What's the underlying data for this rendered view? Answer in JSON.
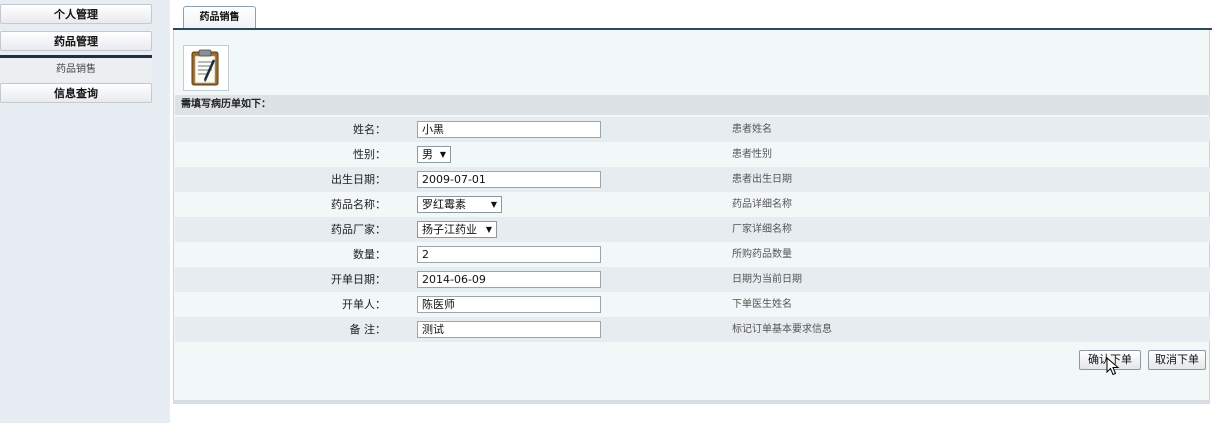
{
  "sidebar": {
    "items": [
      {
        "label": "个人管理"
      },
      {
        "label": "药品管理"
      },
      {
        "label": "药品销售"
      },
      {
        "label": "信息查询"
      }
    ]
  },
  "tab": {
    "label": "药品销售"
  },
  "section": {
    "title": "需填写病历单如下："
  },
  "form": {
    "rows": [
      {
        "label": "姓名：",
        "value": "小黑",
        "hint": "患者姓名"
      },
      {
        "label": "性别：",
        "value": "男",
        "hint": "患者性别"
      },
      {
        "label": "出生日期：",
        "value": "2009-07-01",
        "hint": "患者出生日期"
      },
      {
        "label": "药品名称：",
        "value": "罗红霉素",
        "hint": "药品详细名称"
      },
      {
        "label": "药品厂家：",
        "value": "扬子江药业",
        "hint": "厂家详细名称"
      },
      {
        "label": "数量：",
        "value": "2",
        "hint": "所购药品数量"
      },
      {
        "label": "开单日期：",
        "value": "2014-06-09",
        "hint": "日期为当前日期"
      },
      {
        "label": "开单人：",
        "value": "陈医师",
        "hint": "下单医生姓名"
      },
      {
        "label": "备 注：",
        "value": "测试",
        "hint": "标记订单基本要求信息"
      }
    ]
  },
  "buttons": {
    "confirm": "确认下单",
    "cancel": "取消下单"
  },
  "colors": {
    "tab_border": "#2c4a5e",
    "panel_bg": "#f2f7f8",
    "row_alt": "#e6ecef"
  },
  "icons": {
    "clipboard": "clipboard-icon",
    "cursor": "mouse-pointer-icon",
    "dropdown": "chevron-down-icon"
  }
}
